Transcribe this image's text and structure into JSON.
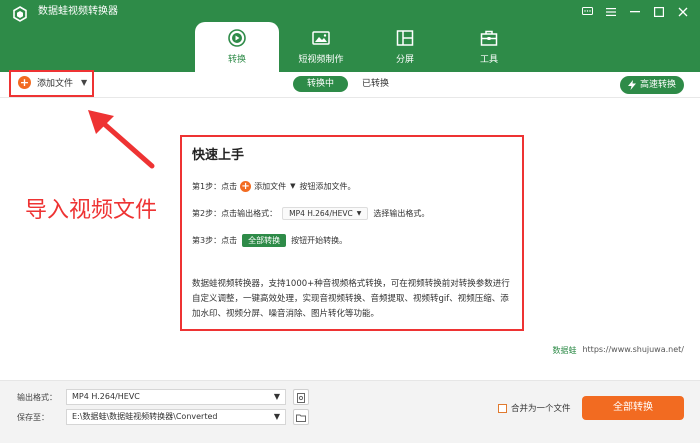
{
  "app": {
    "title": "数据蛙视频转换器"
  },
  "window_controls": {
    "feedback": "feedback-icon",
    "menu": "menu-icon",
    "minimize": "minimize-icon",
    "maximize": "maximize-icon",
    "close": "close-icon"
  },
  "nav": {
    "tabs": [
      {
        "label": "转换",
        "icon": "convert-icon",
        "active": true
      },
      {
        "label": "短视频制作",
        "icon": "short-video-icon",
        "active": false
      },
      {
        "label": "分屏",
        "icon": "split-screen-icon",
        "active": false
      },
      {
        "label": "工具",
        "icon": "toolbox-icon",
        "active": false
      }
    ]
  },
  "toolbar": {
    "add_file_label": "添加文件",
    "sub_tabs": [
      "转换中",
      "已转换"
    ],
    "high_speed_label": "高速转换"
  },
  "annotation": {
    "label": "导入视频文件"
  },
  "quick_start": {
    "title": "快速上手",
    "step1": {
      "prefix": "第1步：点击",
      "button": "添加文件",
      "suffix": "按钮添加文件。"
    },
    "step2": {
      "prefix": "第2步：点击输出格式：",
      "format": "MP4 H.264/HEVC",
      "suffix": "选择输出格式。"
    },
    "step3": {
      "prefix": "第3步：点击",
      "button": "全部转换",
      "suffix": "按钮开始转换。"
    },
    "description": "数据蛙视频转换器，支持1000+种音视频格式转换，可在视频转换前对转换参数进行自定义调整，一键高效处理，实现音视频转换、音频提取、视频转gif、视频压缩、添加水印、视频分屏、噪音消除、图片转化等功能。"
  },
  "watermark": {
    "brand": "数据蛙",
    "url": "https://www.shujuwa.net/"
  },
  "bottom": {
    "output_format_label": "输出格式：",
    "output_format_value": "MP4 H.264/HEVC",
    "save_to_label": "保存至：",
    "save_to_value": "E:\\数据蛙\\数据蛙视频转换器\\Converted",
    "merge_label": "合并为一个文件",
    "convert_all_label": "全部转换"
  },
  "colors": {
    "brand_green": "#2e8b48",
    "accent_orange": "#f26b21",
    "annotation_red": "#e33333"
  }
}
